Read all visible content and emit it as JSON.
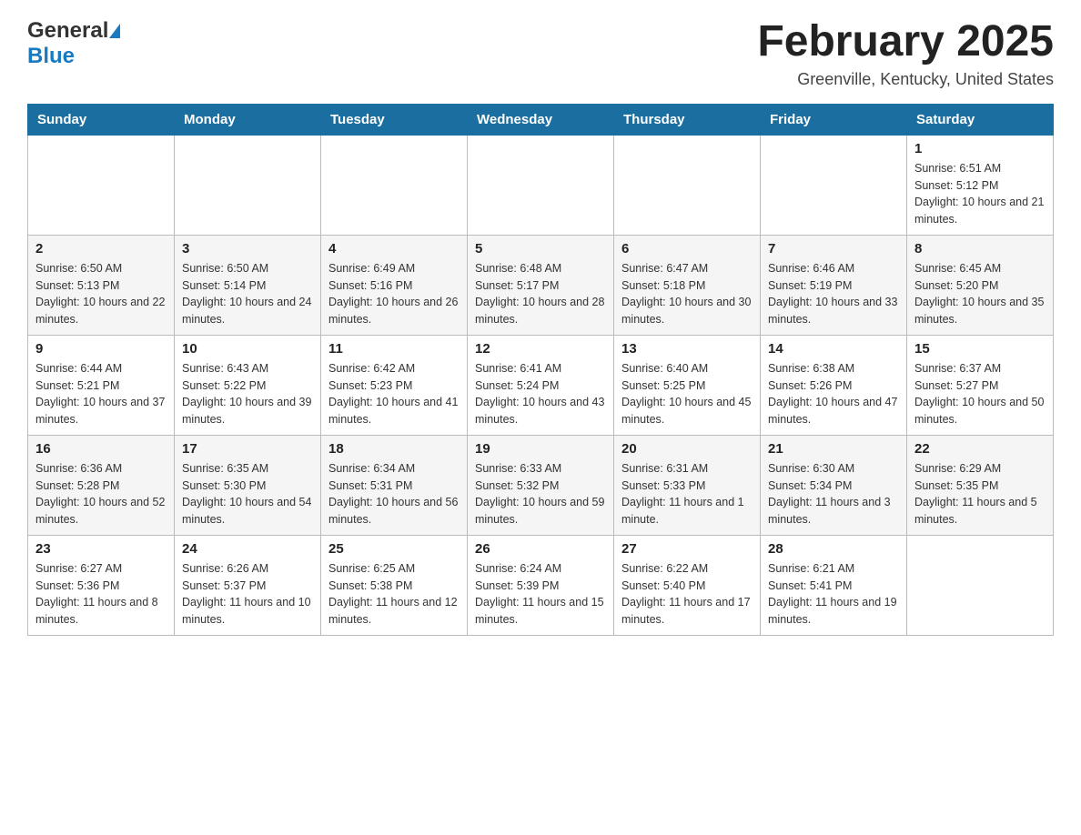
{
  "logo": {
    "general": "General",
    "blue": "Blue"
  },
  "header": {
    "title": "February 2025",
    "subtitle": "Greenville, Kentucky, United States"
  },
  "days_of_week": [
    "Sunday",
    "Monday",
    "Tuesday",
    "Wednesday",
    "Thursday",
    "Friday",
    "Saturday"
  ],
  "weeks": [
    {
      "cells": [
        {
          "day": "",
          "info": ""
        },
        {
          "day": "",
          "info": ""
        },
        {
          "day": "",
          "info": ""
        },
        {
          "day": "",
          "info": ""
        },
        {
          "day": "",
          "info": ""
        },
        {
          "day": "",
          "info": ""
        },
        {
          "day": "1",
          "info": "Sunrise: 6:51 AM\nSunset: 5:12 PM\nDaylight: 10 hours and 21 minutes."
        }
      ]
    },
    {
      "cells": [
        {
          "day": "2",
          "info": "Sunrise: 6:50 AM\nSunset: 5:13 PM\nDaylight: 10 hours and 22 minutes."
        },
        {
          "day": "3",
          "info": "Sunrise: 6:50 AM\nSunset: 5:14 PM\nDaylight: 10 hours and 24 minutes."
        },
        {
          "day": "4",
          "info": "Sunrise: 6:49 AM\nSunset: 5:16 PM\nDaylight: 10 hours and 26 minutes."
        },
        {
          "day": "5",
          "info": "Sunrise: 6:48 AM\nSunset: 5:17 PM\nDaylight: 10 hours and 28 minutes."
        },
        {
          "day": "6",
          "info": "Sunrise: 6:47 AM\nSunset: 5:18 PM\nDaylight: 10 hours and 30 minutes."
        },
        {
          "day": "7",
          "info": "Sunrise: 6:46 AM\nSunset: 5:19 PM\nDaylight: 10 hours and 33 minutes."
        },
        {
          "day": "8",
          "info": "Sunrise: 6:45 AM\nSunset: 5:20 PM\nDaylight: 10 hours and 35 minutes."
        }
      ]
    },
    {
      "cells": [
        {
          "day": "9",
          "info": "Sunrise: 6:44 AM\nSunset: 5:21 PM\nDaylight: 10 hours and 37 minutes."
        },
        {
          "day": "10",
          "info": "Sunrise: 6:43 AM\nSunset: 5:22 PM\nDaylight: 10 hours and 39 minutes."
        },
        {
          "day": "11",
          "info": "Sunrise: 6:42 AM\nSunset: 5:23 PM\nDaylight: 10 hours and 41 minutes."
        },
        {
          "day": "12",
          "info": "Sunrise: 6:41 AM\nSunset: 5:24 PM\nDaylight: 10 hours and 43 minutes."
        },
        {
          "day": "13",
          "info": "Sunrise: 6:40 AM\nSunset: 5:25 PM\nDaylight: 10 hours and 45 minutes."
        },
        {
          "day": "14",
          "info": "Sunrise: 6:38 AM\nSunset: 5:26 PM\nDaylight: 10 hours and 47 minutes."
        },
        {
          "day": "15",
          "info": "Sunrise: 6:37 AM\nSunset: 5:27 PM\nDaylight: 10 hours and 50 minutes."
        }
      ]
    },
    {
      "cells": [
        {
          "day": "16",
          "info": "Sunrise: 6:36 AM\nSunset: 5:28 PM\nDaylight: 10 hours and 52 minutes."
        },
        {
          "day": "17",
          "info": "Sunrise: 6:35 AM\nSunset: 5:30 PM\nDaylight: 10 hours and 54 minutes."
        },
        {
          "day": "18",
          "info": "Sunrise: 6:34 AM\nSunset: 5:31 PM\nDaylight: 10 hours and 56 minutes."
        },
        {
          "day": "19",
          "info": "Sunrise: 6:33 AM\nSunset: 5:32 PM\nDaylight: 10 hours and 59 minutes."
        },
        {
          "day": "20",
          "info": "Sunrise: 6:31 AM\nSunset: 5:33 PM\nDaylight: 11 hours and 1 minute."
        },
        {
          "day": "21",
          "info": "Sunrise: 6:30 AM\nSunset: 5:34 PM\nDaylight: 11 hours and 3 minutes."
        },
        {
          "day": "22",
          "info": "Sunrise: 6:29 AM\nSunset: 5:35 PM\nDaylight: 11 hours and 5 minutes."
        }
      ]
    },
    {
      "cells": [
        {
          "day": "23",
          "info": "Sunrise: 6:27 AM\nSunset: 5:36 PM\nDaylight: 11 hours and 8 minutes."
        },
        {
          "day": "24",
          "info": "Sunrise: 6:26 AM\nSunset: 5:37 PM\nDaylight: 11 hours and 10 minutes."
        },
        {
          "day": "25",
          "info": "Sunrise: 6:25 AM\nSunset: 5:38 PM\nDaylight: 11 hours and 12 minutes."
        },
        {
          "day": "26",
          "info": "Sunrise: 6:24 AM\nSunset: 5:39 PM\nDaylight: 11 hours and 15 minutes."
        },
        {
          "day": "27",
          "info": "Sunrise: 6:22 AM\nSunset: 5:40 PM\nDaylight: 11 hours and 17 minutes."
        },
        {
          "day": "28",
          "info": "Sunrise: 6:21 AM\nSunset: 5:41 PM\nDaylight: 11 hours and 19 minutes."
        },
        {
          "day": "",
          "info": ""
        }
      ]
    }
  ]
}
